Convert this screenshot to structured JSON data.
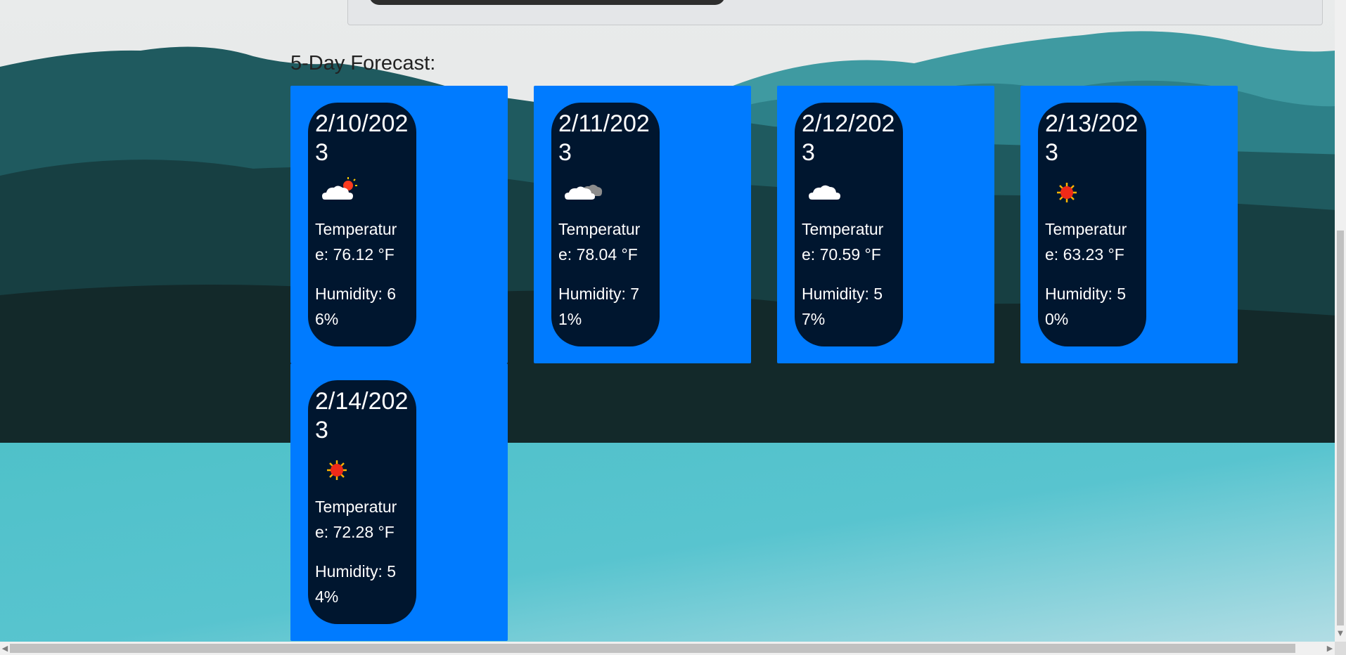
{
  "forecast": {
    "title": "5-Day Forecast:",
    "days": [
      {
        "date": "2/10/2023",
        "icon": "partly-cloudy-sun-icon",
        "temperature": "Temperature: 76.12 °F",
        "humidity": "Humidity: 66%"
      },
      {
        "date": "2/11/2023",
        "icon": "cloud-dark-icon",
        "temperature": "Temperature: 78.04 °F",
        "humidity": "Humidity: 71%"
      },
      {
        "date": "2/12/2023",
        "icon": "cloud-icon",
        "temperature": "Temperature: 70.59 °F",
        "humidity": "Humidity: 57%"
      },
      {
        "date": "2/13/2023",
        "icon": "sun-icon",
        "temperature": "Temperature: 63.23 °F",
        "humidity": "Humidity: 50%"
      },
      {
        "date": "2/14/2023",
        "icon": "sun-icon",
        "temperature": "Temperature: 72.28 °F",
        "humidity": "Humidity: 54%"
      }
    ]
  },
  "colors": {
    "card": "#007bff",
    "pill": "#00162f",
    "text": "#ffffff"
  }
}
